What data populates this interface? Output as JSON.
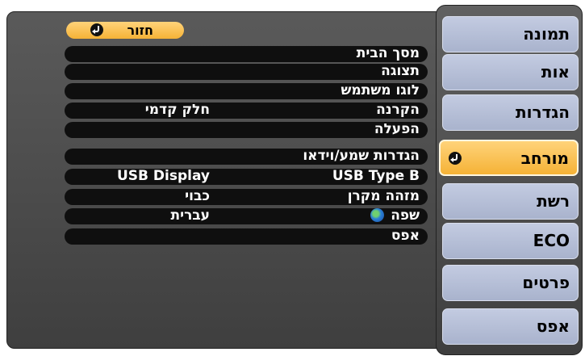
{
  "menu": {
    "items": [
      {
        "label": "תמונה",
        "selected": false
      },
      {
        "label": "אות",
        "selected": false
      },
      {
        "label": "הגדרות",
        "selected": false
      },
      {
        "label": "מורחב",
        "selected": true
      },
      {
        "label": "רשת",
        "selected": false
      },
      {
        "label": "ECO",
        "selected": false
      },
      {
        "label": "פרטים",
        "selected": false
      },
      {
        "label": "אפס",
        "selected": false
      }
    ]
  },
  "submenu": {
    "back_label": "חזור",
    "rows": [
      {
        "label": "מסך הבית",
        "value": ""
      },
      {
        "label": "תצוגה",
        "value": ""
      },
      {
        "label": "לוגו משתמש",
        "value": ""
      },
      {
        "label": "הקרנה",
        "value": "חלק קדמי"
      },
      {
        "label": "הפעלה",
        "value": ""
      },
      {
        "label": "הגדרות שמע/וידאו",
        "value": ""
      },
      {
        "label": "USB Type B",
        "value": "USB Display"
      },
      {
        "label": "מזהה מקרן",
        "value": "כבוי"
      },
      {
        "label": "שפה",
        "value": "עברית",
        "icon": "globe-icon"
      },
      {
        "label": "אפס",
        "value": ""
      }
    ]
  },
  "colors": {
    "accent": "#f5b236",
    "menu_item": "#b3bcd5",
    "panel": "#4a4a4a"
  }
}
